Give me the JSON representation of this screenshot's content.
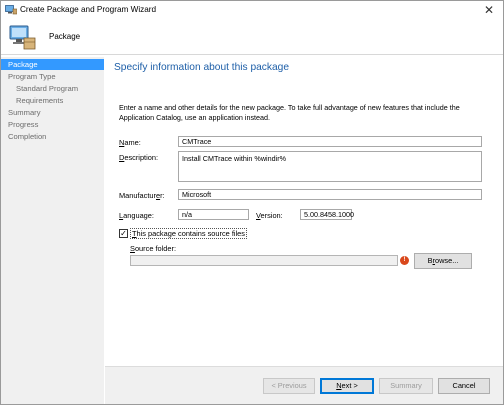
{
  "window": {
    "title": "Create Package and Program Wizard",
    "close_glyph": "✕"
  },
  "header": {
    "title": "Package"
  },
  "nav": {
    "items": [
      {
        "label": "Package",
        "active": true
      },
      {
        "label": "Program Type",
        "active": false
      },
      {
        "label": "Standard Program",
        "active": false
      },
      {
        "label": "Requirements",
        "active": false
      },
      {
        "label": "Summary",
        "active": false
      },
      {
        "label": "Progress",
        "active": false
      },
      {
        "label": "Completion",
        "active": false
      }
    ]
  },
  "main": {
    "heading": "Specify information about this package",
    "intro": "Enter a name and other details for the new package. To take full advantage of new features that include the Application Catalog, use an application instead."
  },
  "form": {
    "name_label_pre": "",
    "name_label_key": "N",
    "name_label_post": "ame:",
    "name_value": "CMTrace",
    "description_label_pre": "",
    "description_label_key": "D",
    "description_label_post": "escription:",
    "description_value": "Install CMTrace within %windir%",
    "manufacturer_label_pre": "Manufactur",
    "manufacturer_label_key": "e",
    "manufacturer_label_post": "r:",
    "manufacturer_value": "Microsoft",
    "language_label_pre": "",
    "language_label_key": "L",
    "language_label_post": "anguage:",
    "language_value": "n/a",
    "version_label_pre": "",
    "version_label_key": "V",
    "version_label_post": "ersion:",
    "version_value": "5.00.8458.1000",
    "contains_source_label_pre": "",
    "contains_source_label_key": "T",
    "contains_source_label_post": "his package contains source files",
    "contains_source_checked": true,
    "source_folder_label_pre": "",
    "source_folder_label_key": "S",
    "source_folder_label_post": "ource folder:",
    "source_folder_value": "",
    "browse_label_pre": "B",
    "browse_label_key": "r",
    "browse_label_post": "owse...",
    "warning_glyph": "!"
  },
  "footer": {
    "previous_label": "< Previous",
    "next_label_pre": "",
    "next_label_key": "N",
    "next_label_post": "ext >",
    "summary_label": "Summary",
    "cancel_label": "Cancel"
  },
  "colors": {
    "accent": "#3399ff",
    "heading": "#1e5fa8",
    "warning": "#d9481c"
  },
  "icons": {
    "title_icon": "computer-package-icon",
    "header_icon": "computer-package-icon",
    "warning_icon": "error-icon"
  }
}
